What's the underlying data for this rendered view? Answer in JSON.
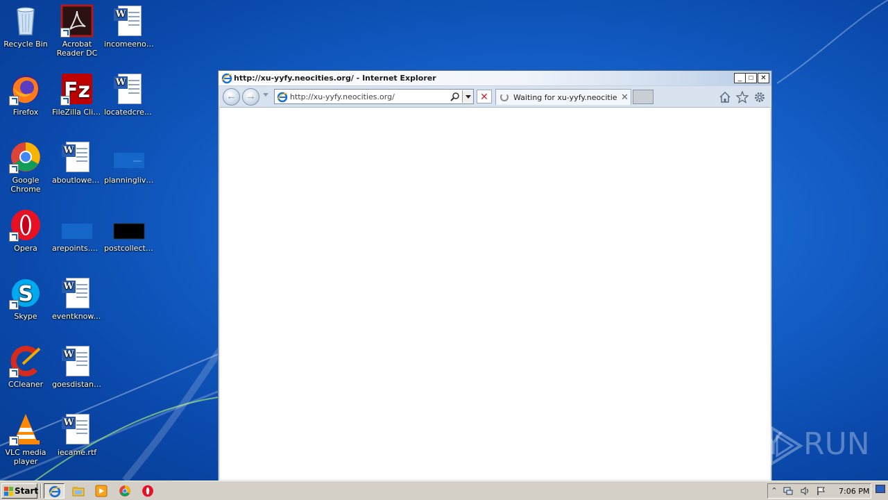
{
  "desktop": {
    "icons": [
      {
        "label": "Recycle Bin",
        "icon": "recycle-bin-icon"
      },
      {
        "label": "Acrobat Reader DC",
        "icon": "acrobat-icon"
      },
      {
        "label": "incomeenou...",
        "icon": "word-document-icon"
      },
      {
        "label": "Firefox",
        "icon": "firefox-icon"
      },
      {
        "label": "FileZilla Client",
        "icon": "filezilla-icon"
      },
      {
        "label": "locatedcrea...",
        "icon": "word-document-icon"
      },
      {
        "label": "Google Chrome",
        "icon": "chrome-icon"
      },
      {
        "label": "aboutlowest...",
        "icon": "word-document-icon"
      },
      {
        "label": "planninglivi...",
        "icon": "image-file-icon"
      },
      {
        "label": "Opera",
        "icon": "opera-icon"
      },
      {
        "label": "arepoints.png",
        "icon": "image-file-icon"
      },
      {
        "label": "postcollecti...",
        "icon": "image-file-icon"
      },
      {
        "label": "Skype",
        "icon": "skype-icon"
      },
      {
        "label": "eventknow.rtf",
        "icon": "word-document-icon"
      },
      {
        "label": "CCleaner",
        "icon": "ccleaner-icon"
      },
      {
        "label": "goesdistanc...",
        "icon": "word-document-icon"
      },
      {
        "label": "VLC media player",
        "icon": "vlc-icon"
      },
      {
        "label": "iecame.rtf",
        "icon": "word-document-icon"
      }
    ]
  },
  "ie": {
    "title": "http://xu-yyfy.neocities.org/ - Internet Explorer",
    "address": "http://xu-yyfy.neocities.org/",
    "tab_title": "Waiting for xu-yyfy.neocitie...",
    "window_buttons": {
      "minimize": "_",
      "maximize": "□",
      "close": "✕"
    },
    "stop": "✕",
    "tab_close": "✕"
  },
  "watermark": {
    "left": "ANY",
    "right": "RUN"
  },
  "taskbar": {
    "start_label": "Start",
    "clock": "7:06 PM",
    "pinned": [
      "internet-explorer-icon",
      "file-explorer-icon",
      "media-player-icon",
      "chrome-icon",
      "opera-icon"
    ]
  },
  "colors": {
    "desktop": "#1460c8",
    "taskbar": "#d4d0c8",
    "window_frame": "#d6dfe9"
  }
}
